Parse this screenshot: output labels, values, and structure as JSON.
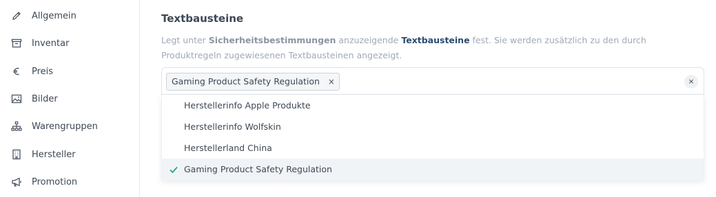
{
  "sidebar": {
    "items": [
      {
        "label": "Allgemein",
        "icon": "pencil-icon"
      },
      {
        "label": "Inventar",
        "icon": "archive-icon"
      },
      {
        "label": "Preis",
        "icon": "euro-icon"
      },
      {
        "label": "Bilder",
        "icon": "image-icon"
      },
      {
        "label": "Warengruppen",
        "icon": "hierarchy-icon"
      },
      {
        "label": "Hersteller",
        "icon": "building-icon"
      },
      {
        "label": "Promotion",
        "icon": "megaphone-icon"
      }
    ]
  },
  "section": {
    "title": "Textbausteine",
    "desc_part1": "Legt unter ",
    "desc_bold1": "Sicherheitsbestimmungen",
    "desc_part2": " anzuzeigende ",
    "desc_link": "Textbausteine",
    "desc_part3": " fest. Sie werden zusätzlich zu den durch Produktregeln zugewiesenen Textbausteinen angezeigt."
  },
  "select": {
    "chip_label": "Gaming Product Safety Regulation",
    "chip_remove": "×",
    "clear": "×",
    "options": [
      {
        "label": "Herstellerinfo Apple Produkte",
        "selected": false
      },
      {
        "label": "Herstellerinfo Wolfskin",
        "selected": false
      },
      {
        "label": "Herstellerland China",
        "selected": false
      },
      {
        "label": "Gaming Product Safety Regulation",
        "selected": true
      }
    ]
  },
  "colors": {
    "check": "#2aa879",
    "link": "#2a4d70"
  }
}
